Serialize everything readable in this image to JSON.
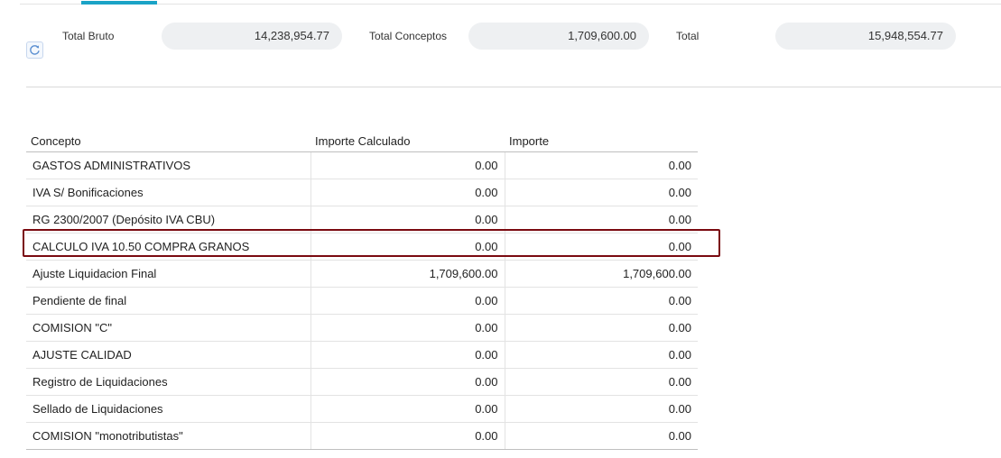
{
  "totals": {
    "bruto_label": "Total Bruto",
    "bruto_value": "14,238,954.77",
    "conceptos_label": "Total Conceptos",
    "conceptos_value": "1,709,600.00",
    "total_label": "Total",
    "total_value": "15,948,554.77"
  },
  "icons": {
    "refresh": "refresh-icon"
  },
  "table": {
    "headers": [
      "Concepto",
      "Importe Calculado",
      "Importe"
    ],
    "rows": [
      {
        "concepto": "GASTOS ADMINISTRATIVOS",
        "calculado": "0.00",
        "importe": "0.00"
      },
      {
        "concepto": "IVA S/ Bonificaciones",
        "calculado": "0.00",
        "importe": "0.00"
      },
      {
        "concepto": "RG 2300/2007 (Depósito IVA CBU)",
        "calculado": "0.00",
        "importe": "0.00"
      },
      {
        "concepto": "CALCULO IVA 10.50 COMPRA GRANOS",
        "calculado": "0.00",
        "importe": "0.00"
      },
      {
        "concepto": "Ajuste Liquidacion Final",
        "calculado": "1,709,600.00",
        "importe": "1,709,600.00"
      },
      {
        "concepto": "Pendiente de final",
        "calculado": "0.00",
        "importe": "0.00"
      },
      {
        "concepto": "COMISION \"C\"",
        "calculado": "0.00",
        "importe": "0.00"
      },
      {
        "concepto": "AJUSTE CALIDAD",
        "calculado": "0.00",
        "importe": "0.00"
      },
      {
        "concepto": "Registro de Liquidaciones",
        "calculado": "0.00",
        "importe": "0.00"
      },
      {
        "concepto": "Sellado de Liquidaciones",
        "calculado": "0.00",
        "importe": "0.00"
      },
      {
        "concepto": "COMISION \"monotributistas\"",
        "calculado": "0.00",
        "importe": "0.00"
      }
    ]
  },
  "colors": {
    "tab_accent": "#1aa3c6",
    "highlight_border": "#7a0a10",
    "total_box_bg": "#eef0f2"
  }
}
